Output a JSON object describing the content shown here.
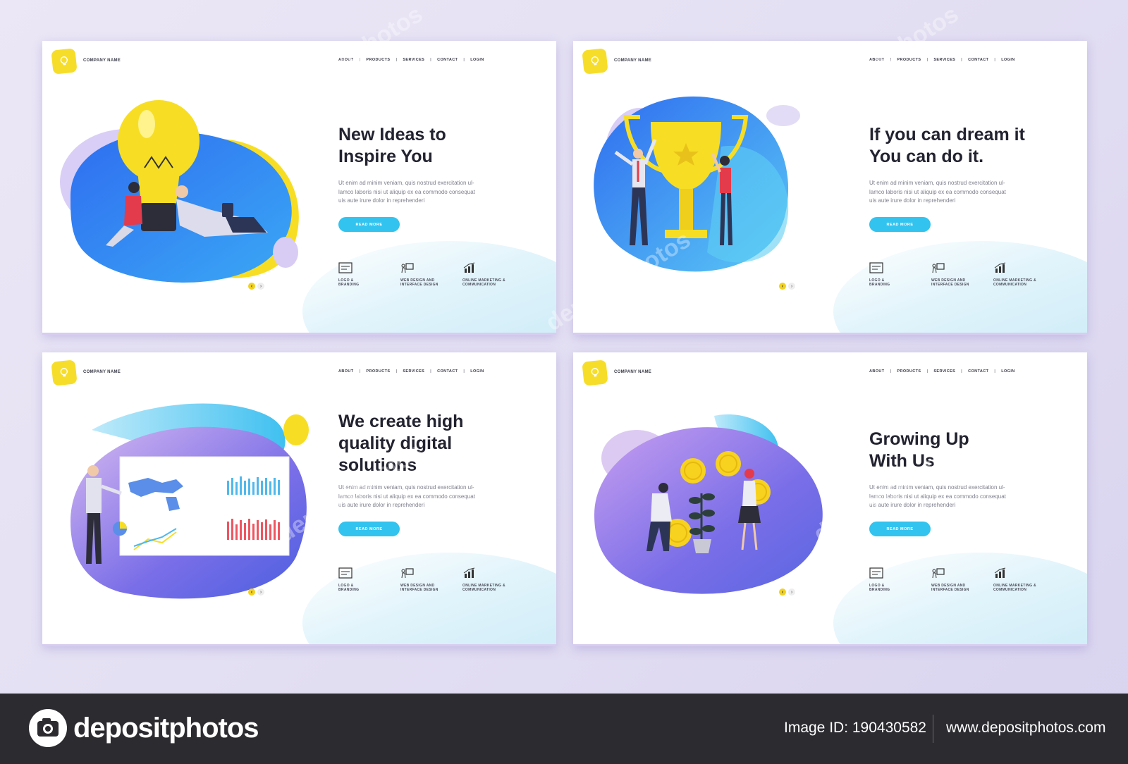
{
  "cards": [
    {
      "company": "COMPANY NAME",
      "nav": [
        "ABOUT",
        "PRODUCTS",
        "SERVICES",
        "CONTACT",
        "LOGIN"
      ],
      "headline": [
        "New Ideas to",
        "Inspire You"
      ],
      "body": [
        "Ut enim ad minim veniam, quis nostrud exercitation ul-",
        "lamco laboris nisi ut aliquip ex ea commodo consequat",
        "uis aute irure dolor in reprehenderi"
      ],
      "button": "READ MORE",
      "services": [
        "LOGO &\nBRANDING",
        "WEB DESIGN AND\nINTERFACE DESIGN",
        "ONLINE MARKETING &\nCOMMUNICATION"
      ]
    },
    {
      "company": "COMPANY NAME",
      "nav": [
        "ABOUT",
        "PRODUCTS",
        "SERVICES",
        "CONTACT",
        "LOGIN"
      ],
      "headline": [
        "If you can dream it",
        "You can do it."
      ],
      "body": [
        "Ut enim ad minim veniam, quis nostrud exercitation ul-",
        "lamco laboris nisi ut aliquip ex ea commodo consequat",
        "uis aute irure dolor in reprehenderi"
      ],
      "button": "READ MORE",
      "services": [
        "LOGO &\nBRANDING",
        "WEB DESIGN AND\nINTERFACE DESIGN",
        "ONLINE MARKETING &\nCOMMUNICATION"
      ]
    },
    {
      "company": "COMPANY NAME",
      "nav": [
        "ABOUT",
        "PRODUCTS",
        "SERVICES",
        "CONTACT",
        "LOGIN"
      ],
      "headline": [
        "We create high",
        "quality digital",
        "solutions"
      ],
      "body": [
        "Ut enim ad minim veniam, quis nostrud exercitation ul-",
        "lamco laboris nisi ut aliquip ex ea commodo consequat",
        "uis aute irure dolor in reprehenderi"
      ],
      "button": "READ MORE",
      "services": [
        "LOGO &\nBRANDING",
        "WEB DESIGN AND\nINTERFACE DESIGN",
        "ONLINE MARKETING &\nCOMMUNICATION"
      ]
    },
    {
      "company": "COMPANY NAME",
      "nav": [
        "ABOUT",
        "PRODUCTS",
        "SERVICES",
        "CONTACT",
        "LOGIN"
      ],
      "headline": [
        "Growing Up",
        "With Us"
      ],
      "body": [
        "Ut enim ad minim veniam, quis nostrud exercitation ul-",
        "lamco laboris nisi ut aliquip ex ea commodo consequat",
        "uis aute irure dolor in reprehenderi"
      ],
      "button": "READ MORE",
      "services": [
        "LOGO &\nBRANDING",
        "WEB DESIGN AND\nINTERFACE DESIGN",
        "ONLINE MARKETING &\nCOMMUNICATION"
      ]
    }
  ],
  "pager": {
    "prev": "‹",
    "next": "›"
  },
  "footer": {
    "brand": "depositphotos",
    "image_id": "Image ID: 190430582",
    "site": "www.depositphotos.com"
  },
  "watermark": "depositphotos",
  "colors": {
    "accent_yellow": "#f6dd2a",
    "button_blue": "#32c3ef",
    "footer_bg": "#2b2b30"
  }
}
